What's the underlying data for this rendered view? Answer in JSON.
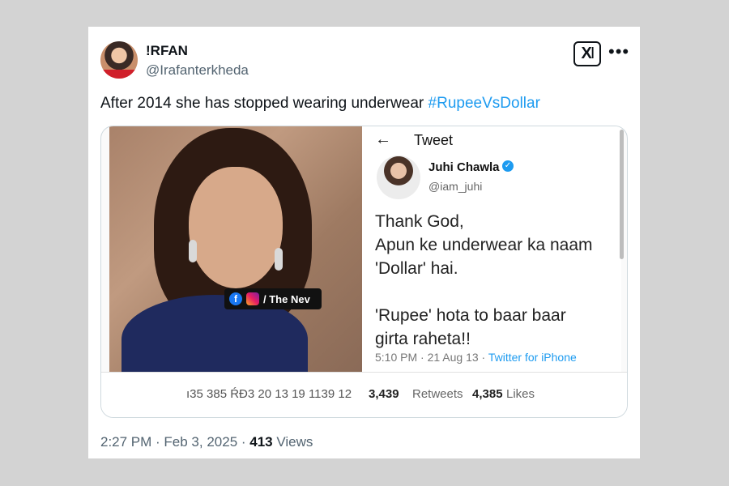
{
  "author": {
    "display_name": "!RFAN",
    "handle": "@Irafanterkheda"
  },
  "tweet": {
    "text": "After 2014 she has stopped wearing underwear ",
    "hashtag": "#RupeeVsDollar"
  },
  "media": {
    "photo_overlay_text": "/ The Nev",
    "embedded": {
      "header_title": "Tweet",
      "name": "Juhi Chawla",
      "handle": "@iam_juhi",
      "body_lines": [
        "Thank God,",
        "Apun ke underwear ka naam",
        "'Dollar' hai.",
        "",
        "'Rupee' hota to baar baar",
        "girta raheta!!"
      ],
      "meta_time": "5:10 PM · 21 Aug 13 · ",
      "meta_source": "Twitter for iPhone"
    },
    "stats": {
      "garbled_prefix": "ı35   385   ŔĐ3 20 13 19 1139 12",
      "retweets_count": "3,439",
      "retweets_label": "Retweets",
      "likes_count": "4,385",
      "likes_label": "Likes"
    }
  },
  "footer": {
    "time_date": "2:27 PM · Feb 3, 2025 · ",
    "views_count": "413",
    "views_label": "Views"
  },
  "icons": {
    "logo": "x-logo-icon",
    "more": "more-options-icon",
    "back": "back-arrow-icon",
    "verified": "verified-badge-icon"
  },
  "colors": {
    "link": "#1d9bf0",
    "text": "#0f1419",
    "muted": "#536471"
  }
}
